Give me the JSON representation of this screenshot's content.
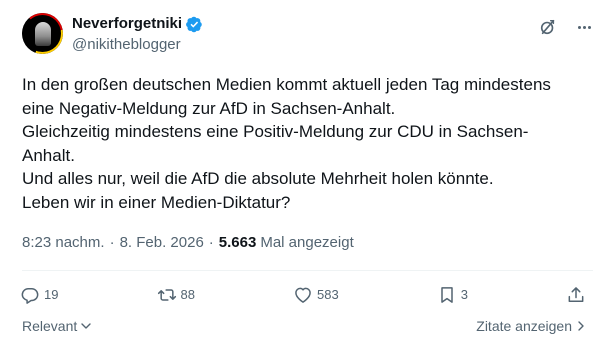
{
  "author": {
    "display_name": "Neverforgetniki",
    "handle": "@nikitheblogger",
    "verified": true,
    "avatar_icon": "profile-avatar"
  },
  "post": {
    "lines": [
      "In den großen deutschen Medien kommt aktuell jeden Tag mindestens",
      "eine Negativ-Meldung zur AfD in Sachsen-Anhalt.",
      "Gleichzeitig mindestens eine Positiv-Meldung zur CDU in Sachsen-",
      "Anhalt.",
      "Und alles nur, weil die AfD die absolute Mehrheit holen könnte.",
      "Leben wir in einer Medien-Diktatur?"
    ]
  },
  "meta": {
    "time": "8:23 nachm.",
    "separator": "·",
    "date": "8. Feb. 2026",
    "views_count": "5.663",
    "views_label": "Mal angezeigt"
  },
  "actions": {
    "replies": "19",
    "reposts": "88",
    "likes": "583",
    "bookmarks": "3"
  },
  "footer": {
    "relevant_label": "Relevant",
    "quotes_label": "Zitate anzeigen"
  },
  "colors": {
    "text_primary": "#0f1419",
    "text_secondary": "#536471",
    "verified_blue": "#1d9bf0",
    "divider": "#eff3f4"
  }
}
